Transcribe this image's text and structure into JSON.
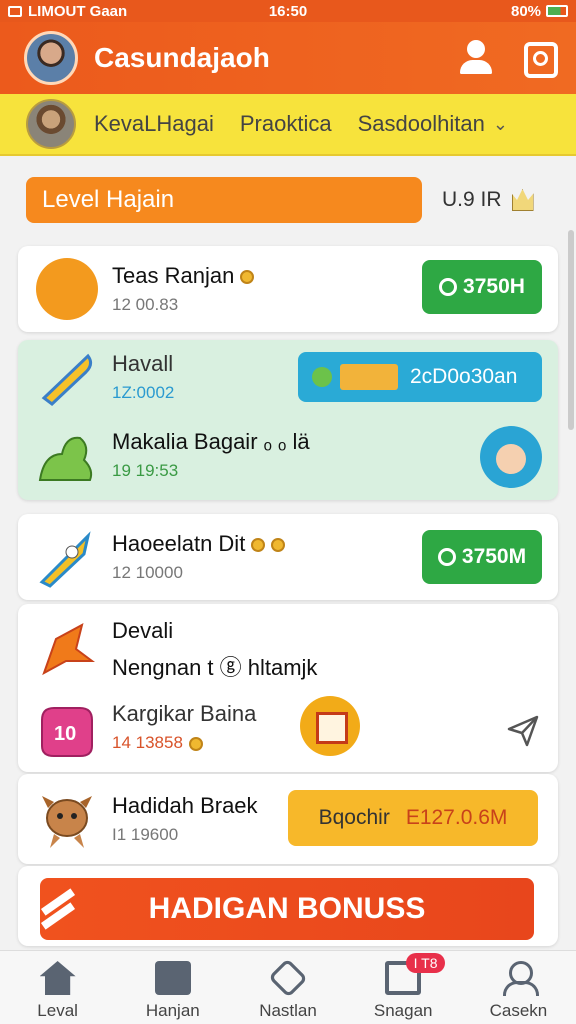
{
  "status_bar": {
    "carrier": "LIMOUT Gaan",
    "time": "16:50",
    "battery": "80%"
  },
  "header": {
    "title": "Casundajaoh"
  },
  "subnav": {
    "tabs": [
      "KevaLHagai",
      "Praoktica",
      "Sasdoolhitan"
    ]
  },
  "level": {
    "label": "Level Hajain",
    "meta": "U.9 IR"
  },
  "items": [
    {
      "title": "Teas Ranjan",
      "time": "12 00.83",
      "badge": "3750H"
    },
    {
      "title": "Havall",
      "time": "1Z:0002",
      "button": "2cD0o30an"
    },
    {
      "title": "Makalia Bagair ₒ ₒ lä",
      "time": "19 19:53"
    },
    {
      "title": "Haoeelatn Dit",
      "time": "12 10000",
      "badge": "3750M"
    },
    {
      "title_line1": "Devali",
      "title_line2": "Nengnan t ⓖ hltamjk"
    },
    {
      "title": "Kargikar Baina",
      "time": "14 13858"
    },
    {
      "title": "Hadidah Braek",
      "time": "I1 19600",
      "button_label": "Bqochir",
      "button_value": "E127.0.6M"
    }
  ],
  "bonus": {
    "label": "HADIGAN BONUSS"
  },
  "tabbar": {
    "tabs": [
      "Leval",
      "Hanjan",
      "Nastlan",
      "Snagan",
      "Casekn"
    ],
    "badge": "I T8"
  },
  "colors": {
    "accent": "#ec5a1c",
    "subnav": "#f7e33c",
    "green": "#2ea844",
    "blue": "#2aaad6",
    "yellow": "#f7b82a"
  }
}
